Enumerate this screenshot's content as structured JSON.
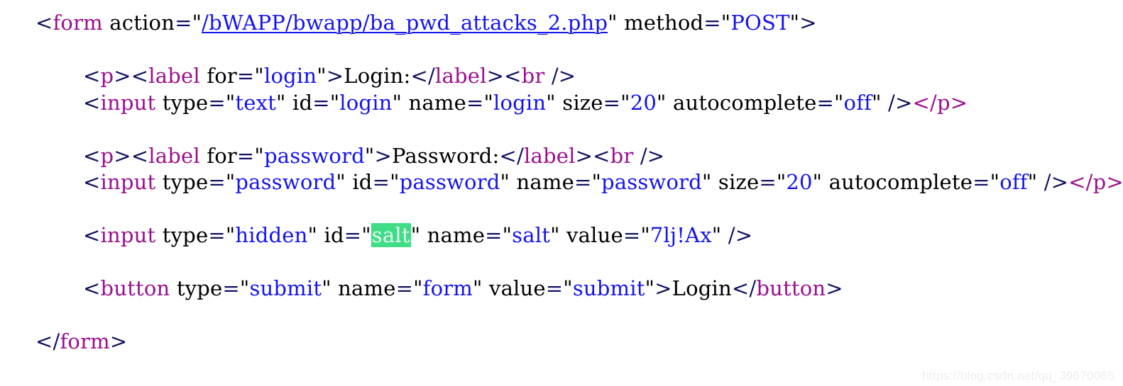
{
  "page": {
    "kind": "html-source-view",
    "background_color": "#ffffff",
    "colors": {
      "punctuation": "#101060",
      "tag_name": "#9b0f8f",
      "attribute_name": "#000000",
      "attribute_value": "#1414ee",
      "text_content": "#000000",
      "link": "#1414ee",
      "search_highlight_background": "#3fdd86",
      "search_highlight_text": "#e9f7ef",
      "watermark": "#ededed"
    }
  },
  "code": {
    "line1": {
      "open_bracket": "<",
      "tag": "form",
      "space1": " ",
      "attr_action": "action",
      "eq1": "=",
      "quote_open1": "\"",
      "link_value": "/bWAPP/bwapp/ba_pwd_attacks_2.php",
      "quote_close1": "\"",
      "space2": " ",
      "attr_method": "method",
      "eq2": "=",
      "quote_open2": "\"",
      "value_post": "POST",
      "quote_close2": "\"",
      "close_bracket": ">"
    },
    "line2": {
      "p_open": "<",
      "p_tag": "p",
      "p_close": ">",
      "label_open": "<",
      "label_tag": "label",
      "space1": " ",
      "attr_for": "for",
      "eq1": "=",
      "quote_open1": "\"",
      "value_login": "login",
      "quote_close1": "\"",
      "gt1": ">",
      "text_login": "Login:",
      "label_end_open": "</",
      "label_end_tag": "label",
      "label_end_close": ">",
      "br_open": "<",
      "br_tag": "br",
      "br_space": " ",
      "br_close": "/>"
    },
    "line3": {
      "open_bracket": "<",
      "tag": "input",
      "space1": " ",
      "attr_type": "type",
      "eq1": "=",
      "q1": "\"",
      "value_type": "text",
      "q2": "\"",
      "space2": " ",
      "attr_id": "id",
      "eq2": "=",
      "q3": "\"",
      "value_id": "login",
      "q4": "\"",
      "space3": " ",
      "attr_name": "name",
      "eq3": "=",
      "q5": "\"",
      "value_name": "login",
      "q6": "\"",
      "space4": " ",
      "attr_size": "size",
      "eq4": "=",
      "q7": "\"",
      "value_size": "20",
      "q8": "\"",
      "space5": " ",
      "attr_autocomplete": "autocomplete",
      "eq5": "=",
      "q9": "\"",
      "value_autocomplete": "off",
      "q10": "\"",
      "space6": " ",
      "self_close": "/>",
      "p_end": "</p>"
    },
    "line5": {
      "p_open": "<",
      "p_tag": "p",
      "p_close": ">",
      "label_open": "<",
      "label_tag": "label",
      "space1": " ",
      "attr_for": "for",
      "eq1": "=",
      "quote_open1": "\"",
      "value_password": "password",
      "quote_close1": "\"",
      "gt1": ">",
      "text_password": "Password:",
      "label_end_open": "</",
      "label_end_tag": "label",
      "label_end_close": ">",
      "br_open": "<",
      "br_tag": "br",
      "br_space": " ",
      "br_close": "/>"
    },
    "line6": {
      "open_bracket": "<",
      "tag": "input",
      "space1": " ",
      "attr_type": "type",
      "eq1": "=",
      "q1": "\"",
      "value_type": "password",
      "q2": "\"",
      "space2": " ",
      "attr_id": "id",
      "eq2": "=",
      "q3": "\"",
      "value_id": "password",
      "q4": "\"",
      "space3": " ",
      "attr_name": "name",
      "eq3": "=",
      "q5": "\"",
      "value_name": "password",
      "q6": "\"",
      "space4": " ",
      "attr_size": "size",
      "eq4": "=",
      "q7": "\"",
      "value_size": "20",
      "q8": "\"",
      "space5": " ",
      "attr_autocomplete": "autocomplete",
      "eq5": "=",
      "q9": "\"",
      "value_autocomplete": "off",
      "q10": "\"",
      "space6": " ",
      "self_close": "/>",
      "p_end": "</p>"
    },
    "line8": {
      "open_bracket": "<",
      "tag": "input",
      "space1": " ",
      "attr_type": "type",
      "eq1": "=",
      "q1": "\"",
      "value_type": "hidden",
      "q2": "\"",
      "space2": " ",
      "attr_id": "id",
      "eq2": "=",
      "q3": "\"",
      "value_id_highlighted": "salt",
      "q4": "\"",
      "space3": " ",
      "attr_name": "name",
      "eq3": "=",
      "q5": "\"",
      "value_name": "salt",
      "q6": "\"",
      "space4": " ",
      "attr_value": "value",
      "eq4": "=",
      "q7": "\"",
      "value_salt": "7lj!Ax",
      "q8": "\"",
      "space5": " ",
      "self_close": "/>"
    },
    "line10": {
      "open_bracket": "<",
      "tag": "button",
      "space1": " ",
      "attr_type": "type",
      "eq1": "=",
      "q1": "\"",
      "value_type": "submit",
      "q2": "\"",
      "space2": " ",
      "attr_name": "name",
      "eq2": "=",
      "q3": "\"",
      "value_name": "form",
      "q4": "\"",
      "space3": " ",
      "attr_value": "value",
      "eq3": "=",
      "q5": "\"",
      "value_value": "submit",
      "q6": "\"",
      "gt": ">",
      "text_login": "Login",
      "end_open": "</",
      "end_tag": "button",
      "end_close": ">"
    },
    "line12": {
      "end_open": "</",
      "tag": "form",
      "end_close": ">"
    }
  },
  "watermark": {
    "text": "https://blog.csdn.net/qq_39670065"
  }
}
